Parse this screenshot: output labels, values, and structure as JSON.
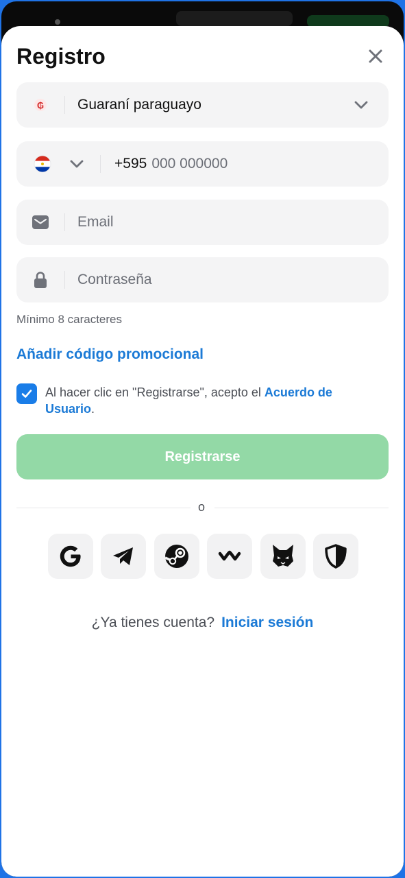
{
  "modal": {
    "title": "Registro",
    "close_icon": "close-icon"
  },
  "currency": {
    "icon": "guarani-currency-icon",
    "value": "Guaraní paraguayo",
    "chevron_icon": "chevron-down-icon",
    "accent": "#d42b2b"
  },
  "phone": {
    "flag_icon": "paraguay-flag-icon",
    "code": "+595",
    "placeholder": "000 000000"
  },
  "email": {
    "icon": "mail-icon",
    "placeholder": "Email"
  },
  "password": {
    "icon": "lock-icon",
    "placeholder": "Contraseña",
    "hint": "Mínimo 8 caracteres"
  },
  "promo": {
    "label": "Añadir código promocional"
  },
  "terms": {
    "checked": true,
    "text": "Al hacer clic en \"Registrarse\", acepto el ",
    "link": "Acuerdo de Usuario",
    "suffix": "."
  },
  "register": {
    "label": "Registrarse",
    "color": "#93d9a6"
  },
  "divider": {
    "label": "o"
  },
  "social": [
    {
      "name": "google-icon"
    },
    {
      "name": "telegram-icon"
    },
    {
      "name": "steam-icon"
    },
    {
      "name": "walletconnect-icon"
    },
    {
      "name": "metamask-fox-icon"
    },
    {
      "name": "shield-icon"
    }
  ],
  "login": {
    "question": "¿Ya tienes cuenta?",
    "link": "Iniciar sesión"
  },
  "colors": {
    "link": "#1b7ad6",
    "checkbox": "#1a7de8",
    "field_bg": "#f4f4f5"
  }
}
